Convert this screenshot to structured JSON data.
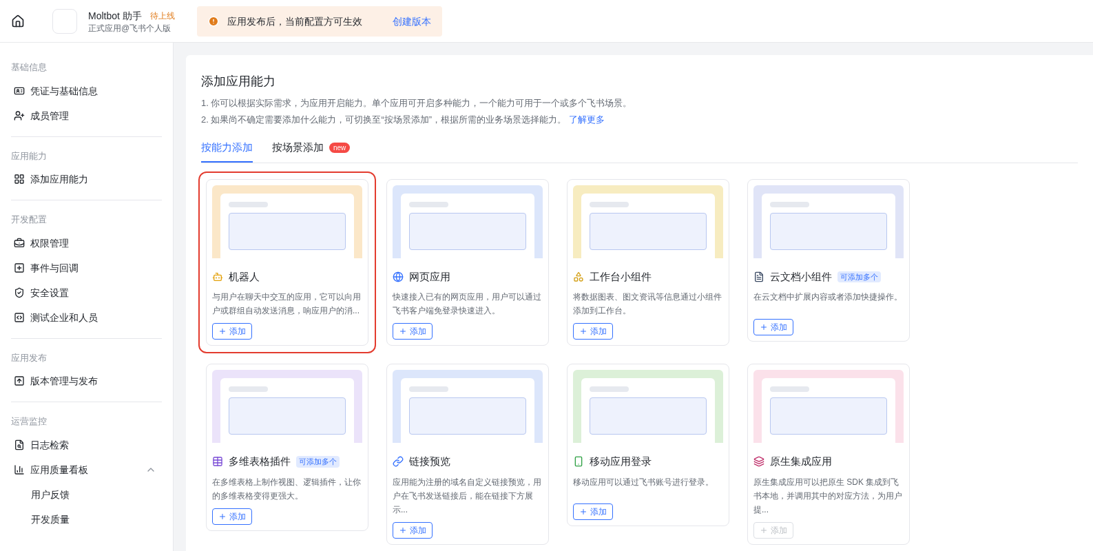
{
  "header": {
    "app_name": "Moltbot 助手",
    "status_badge": "待上线",
    "subtitle": "正式应用@飞书个人版",
    "notice": "应用发布后，当前配置方可生效",
    "notice_link": "创建版本"
  },
  "sidebar": {
    "sections": [
      {
        "title": "基础信息",
        "items": [
          {
            "label": "凭证与基础信息"
          },
          {
            "label": "成员管理"
          }
        ]
      },
      {
        "title": "应用能力",
        "items": [
          {
            "label": "添加应用能力"
          }
        ]
      },
      {
        "title": "开发配置",
        "items": [
          {
            "label": "权限管理"
          },
          {
            "label": "事件与回调"
          },
          {
            "label": "安全设置"
          },
          {
            "label": "测试企业和人员"
          }
        ]
      },
      {
        "title": "应用发布",
        "items": [
          {
            "label": "版本管理与发布"
          }
        ]
      },
      {
        "title": "运营监控",
        "items": [
          {
            "label": "日志检索"
          },
          {
            "label": "应用质量看板",
            "expanded": true,
            "children": [
              {
                "label": "用户反馈"
              },
              {
                "label": "开发质量"
              }
            ]
          }
        ]
      }
    ]
  },
  "main": {
    "title": "添加应用能力",
    "notes": [
      "1. 你可以根据实际需求，为应用开启能力。单个应用可开启多种能力，一个能力可用于一个或多个飞书场景。",
      "2. 如果尚不确定需要添加什么能力，可切换至“按场景添加”，根据所需的业务场景选择能力。"
    ],
    "learn_more": "了解更多",
    "tabs": [
      {
        "label": "按能力添加",
        "selected": true
      },
      {
        "label": "按场景添加",
        "selected": false,
        "badge": "new"
      }
    ],
    "cards": [
      {
        "title": "机器人",
        "description": "与用户在聊天中交互的应用，它可以向用户或群组自动发送消息，响应用户的消...",
        "button": "添加",
        "selected": true,
        "disabled": false
      },
      {
        "title": "网页应用",
        "description": "快速接入已有的网页应用，用户可以通过飞书客户端免登录快速进入。",
        "button": "添加",
        "selected": false,
        "disabled": false
      },
      {
        "title": "工作台小组件",
        "description": "将数据图表、图文资讯等信息通过小组件添加到工作台。",
        "button": "添加",
        "selected": false,
        "disabled": false
      },
      {
        "title": "云文档小组件",
        "tag": "可添加多个",
        "description": "在云文档中扩展内容或者添加快捷操作。",
        "button": "添加",
        "selected": false,
        "disabled": false
      },
      {
        "title": "多维表格插件",
        "tag": "可添加多个",
        "description": "在多维表格上制作视图、逻辑插件，让你的多维表格变得更强大。",
        "button": "添加",
        "selected": false,
        "disabled": false
      },
      {
        "title": "链接预览",
        "description": "应用能为注册的域名自定义链接预览，用户在飞书发送链接后，能在链接下方展示...",
        "button": "添加",
        "selected": false,
        "disabled": false
      },
      {
        "title": "移动应用登录",
        "description": "移动应用可以通过飞书账号进行登录。",
        "button": "添加",
        "selected": false,
        "disabled": false
      },
      {
        "title": "原生集成应用",
        "description": "原生集成应用可以把原生 SDK 集成到飞书本地，并调用其中的对应方法，为用户提...",
        "button": "添加",
        "selected": false,
        "disabled": true
      }
    ]
  }
}
